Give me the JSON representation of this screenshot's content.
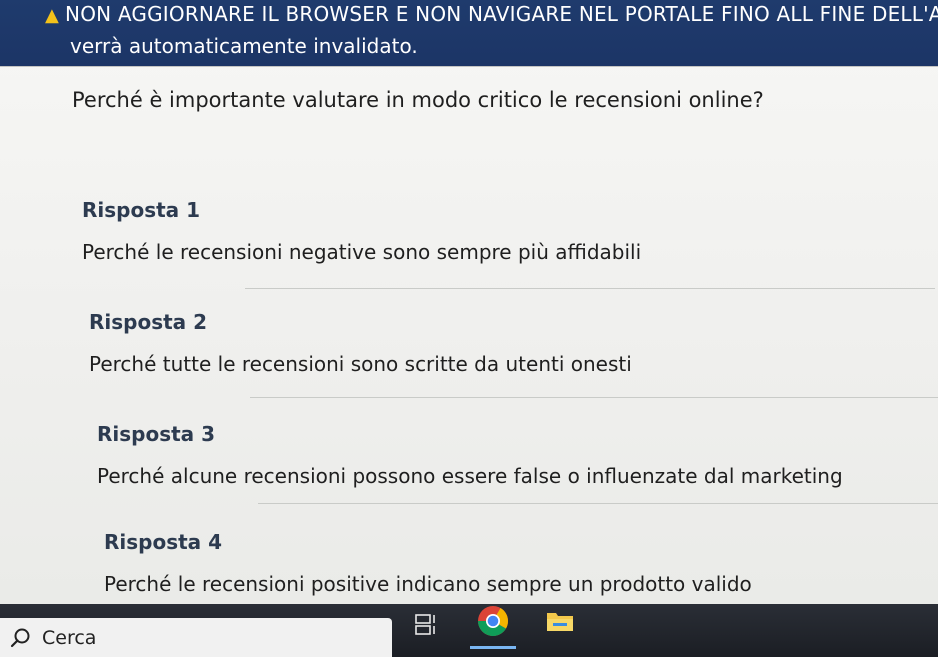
{
  "banner": {
    "line1": "NON AGGIORNARE IL BROWSER E NON NAVIGARE NEL PORTALE FINO ALL FINE DELL'AS",
    "line2": "verrà automaticamente invalidato.",
    "warning_icon": "warning-triangle-icon",
    "background": "#1f3b6d",
    "icon_color": "#f3c21a"
  },
  "question": {
    "text": "Perché è importante valutare in modo critico le recensioni online?"
  },
  "answers": [
    {
      "title": "Risposta 1",
      "text": "Perché le recensioni negative sono sempre più affidabili"
    },
    {
      "title": "Risposta 2",
      "text": "Perché tutte le recensioni sono scritte da utenti onesti"
    },
    {
      "title": "Risposta 3",
      "text": "Perché alcune recensioni possono essere false o influenzate dal marketing"
    },
    {
      "title": "Risposta 4",
      "text": "Perché le recensioni positive indicano sempre un prodotto valido"
    }
  ],
  "taskbar": {
    "search_label": "Cerca",
    "icons": [
      "search-icon",
      "task-view-icon",
      "chrome-icon",
      "file-explorer-icon"
    ],
    "accent": "#7ab6f2"
  }
}
